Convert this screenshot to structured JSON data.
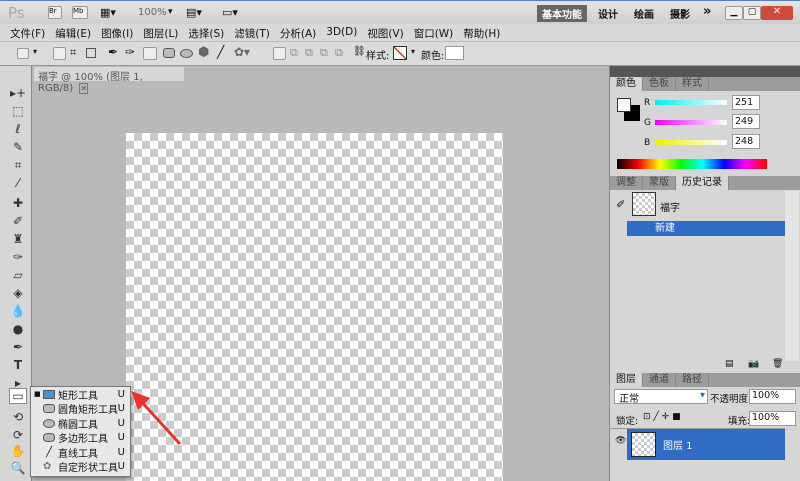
{
  "app": {
    "logo": "Ps",
    "zoom": "100%",
    "workspaces": [
      "基本功能",
      "设计",
      "绘画",
      "摄影"
    ],
    "more": "»"
  },
  "menu": [
    "文件(F)",
    "编辑(E)",
    "图像(I)",
    "图层(L)",
    "选择(S)",
    "滤镜(T)",
    "分析(A)",
    "3D(D)",
    "视图(V)",
    "窗口(W)",
    "帮助(H)"
  ],
  "options": {
    "style_label": "样式:",
    "color_label": "颜色:"
  },
  "document": {
    "tab": "福字 @ 100% (图层 1, RGB/8)"
  },
  "flyout": {
    "items": [
      {
        "label": "矩形工具",
        "key": "U",
        "active": true
      },
      {
        "label": "圆角矩形工具",
        "key": "U"
      },
      {
        "label": "椭圆工具",
        "key": "U"
      },
      {
        "label": "多边形工具",
        "key": "U"
      },
      {
        "label": "直线工具",
        "key": "U"
      },
      {
        "label": "自定形状工具",
        "key": "U"
      }
    ]
  },
  "color_panel": {
    "tabs": [
      "颜色",
      "色板",
      "样式"
    ],
    "r_label": "R",
    "g_label": "G",
    "b_label": "B",
    "r": "251",
    "g": "249",
    "b": "248"
  },
  "history_panel": {
    "tabs": [
      "调整",
      "蒙版",
      "历史记录"
    ],
    "snapshot": "福字",
    "items": [
      "新建"
    ]
  },
  "layers_panel": {
    "tabs": [
      "图层",
      "通道",
      "路径"
    ],
    "blend": "正常",
    "opacity_label": "不透明度:",
    "opacity": "100%",
    "lock_label": "锁定:",
    "fill_label": "填充:",
    "fill": "100%",
    "layer": "图层 1"
  },
  "colors": {
    "accent": "#2f6cc5",
    "arrow": "#e8332f"
  }
}
